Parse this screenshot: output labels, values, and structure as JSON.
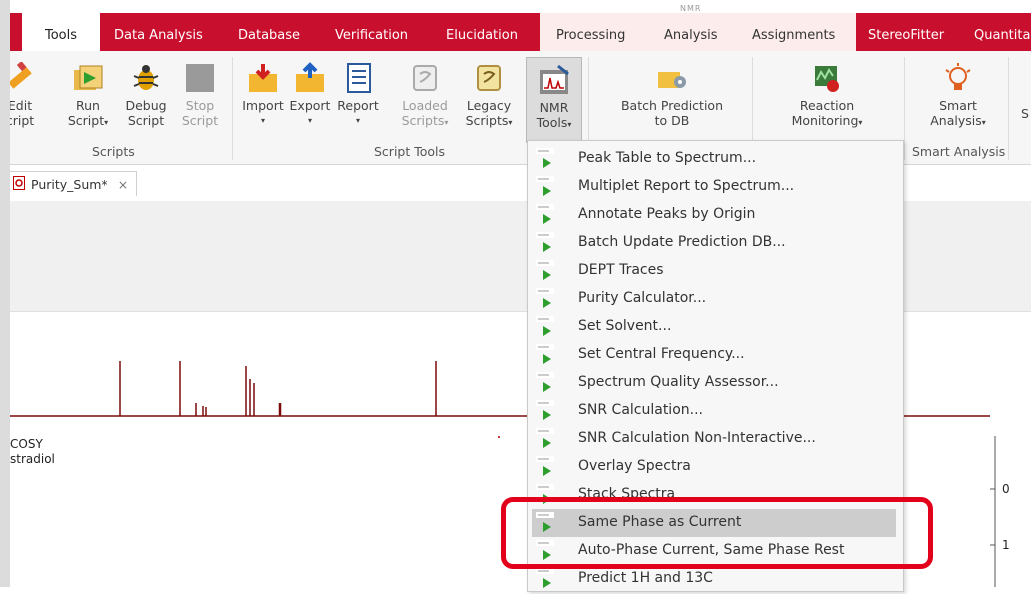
{
  "ribbon_tabs": {
    "tools": "Tools",
    "data_analysis": "Data Analysis",
    "database": "Database",
    "verification": "Verification",
    "elucidation": "Elucidation",
    "nmr_context": "NMR",
    "processing": "Processing",
    "analysis": "Analysis",
    "assignments": "Assignments",
    "stereofitter": "StereoFitter",
    "quantita": "Quantita"
  },
  "ribbon": {
    "edit_script": [
      "Edit",
      "cript"
    ],
    "run_script": [
      "Run",
      "Script"
    ],
    "debug_script": [
      "Debug",
      "Script"
    ],
    "stop_script": [
      "Stop",
      "Script"
    ],
    "import": "Import",
    "export": "Export",
    "report": "Report",
    "loaded_scripts": [
      "Loaded",
      "Scripts"
    ],
    "legacy_scripts": [
      "Legacy",
      "Scripts"
    ],
    "nmr_tools": [
      "NMR",
      "Tools"
    ],
    "batch_prediction": [
      "Batch Prediction",
      "to DB"
    ],
    "reaction_monitoring": [
      "Reaction",
      "Monitoring"
    ],
    "smart_analysis": [
      "Smart",
      "Analysis"
    ],
    "cut_s": "S",
    "caret": "▾",
    "group_scripts": "Scripts",
    "group_script_tools": "Script Tools",
    "group_smart_analysis": "Smart Analysis"
  },
  "document_tab": {
    "label": "Purity_Sum*",
    "close": "×"
  },
  "spectrum": {
    "label_line1": "COSY",
    "label_line2": "stradiol",
    "axis_tick_0": "0",
    "axis_tick_1": "1"
  },
  "nmr_tools_menu": {
    "items": [
      "Peak Table to Spectrum...",
      "Multiplet Report to Spectrum...",
      "Annotate Peaks by Origin",
      "Batch Update Prediction DB...",
      "DEPT Traces",
      "Purity Calculator...",
      "Set Solvent...",
      "Set Central Frequency...",
      "Spectrum Quality Assessor...",
      "SNR Calculation...",
      "SNR Calculation Non-Interactive...",
      "Overlay Spectra",
      "Stack Spectra",
      "Same Phase as Current",
      "Auto-Phase Current, Same Phase Rest",
      "Predict 1H and 13C"
    ],
    "highlighted_index": 13
  },
  "colors": {
    "brand_red": "#c8102e",
    "menu_highlight": "#cdcdcd",
    "callout_red": "#e3001b",
    "spectrum": "#7a0a0a",
    "run_icon_green": "#2e9e2e"
  }
}
